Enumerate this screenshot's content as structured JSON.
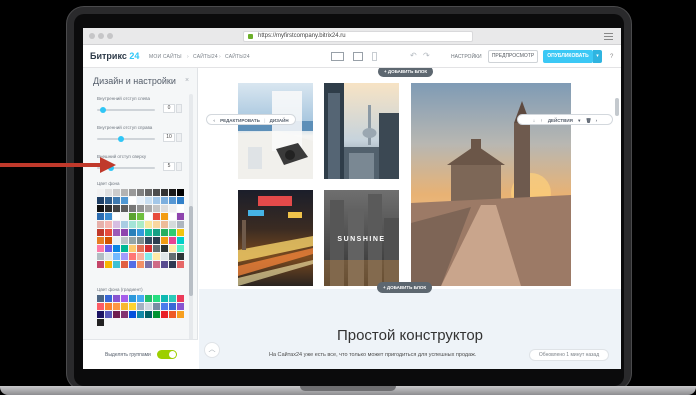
{
  "browser": {
    "url": "https://myfirstcompany.bitrix24.ru"
  },
  "toolbar": {
    "brand": "Битрикс",
    "brand_number": "24",
    "nav": [
      "МОИ САЙТЫ",
      "САЙТЫ24",
      "САЙТЫ24"
    ],
    "settings": "НАСТРОЙКИ",
    "preview": "ПРЕДПРОСМОТР",
    "publish": "ОПУБЛИКОВАТЬ",
    "help": "?"
  },
  "panel": {
    "title": "Дизайн и настройки",
    "close": "×",
    "fields": [
      {
        "label": "Внутренний отступ слева",
        "value": "0",
        "fraction": 0.05
      },
      {
        "label": "Внутренний отступ справа",
        "value": "10",
        "fraction": 0.4
      },
      {
        "label": "Внешний отступ сверху",
        "value": "5",
        "fraction": 0.22
      }
    ],
    "bg_color_label": "Цвет фона",
    "bg_gradient_label": "Цвет фона (градиент)",
    "footer_label": "Выделять группами",
    "toggle_on": true
  },
  "colors": {
    "accent": "#2fc6f6",
    "publish": "#3bc8f5",
    "toggle": "#9dcf00",
    "annotation": "#c0392b",
    "swatches_a": [
      "#f2f2f2",
      "#e0e0e0",
      "#cccccc",
      "#b3b3b3",
      "#999999",
      "#808080",
      "#666666",
      "#4d4d4d",
      "#333333",
      "#1a1a1a",
      "#000000",
      "#1e3f66",
      "#2e5c8a",
      "#3f7ab0",
      "#4f98d4",
      "#ffffff",
      "#e8f1fa",
      "#c9dff2",
      "#a3c7e8",
      "#7dafde",
      "#5797d3",
      "#3180c9",
      "#111111",
      "#2b2b2b",
      "#444444",
      "#5e5e5e",
      "#777777",
      "#919191",
      "#aaaaaa",
      "#c4c4c4",
      "#dddddd",
      "#f0f0f0",
      "#ffffff",
      "#2b6cb0",
      "#3c8dd0",
      "#ffffff",
      "#f5f5f5",
      "#5aa32f",
      "#6fbf3e",
      "#ffffff",
      "#e74c3c",
      "#f39c12",
      "#ffffff",
      "#8e44ad",
      "#e6b0aa",
      "#f5b7b1",
      "#d7bde2",
      "#a9cce3",
      "#a3e4d7",
      "#abebc6",
      "#f9e79f",
      "#fad7a0",
      "#edbb99",
      "#d5dbdb",
      "#aeb6bf",
      "#c0392b",
      "#e74c3c",
      "#9b59b6",
      "#8e44ad",
      "#2980b9",
      "#3498db",
      "#1abc9c",
      "#16a085",
      "#27ae60",
      "#2ecc71",
      "#f1c40f",
      "#e67e22",
      "#d35400",
      "#ecf0f1",
      "#bdc3c7",
      "#95a5a6",
      "#7f8c8d",
      "#34495e",
      "#2c3e50",
      "#f39c12",
      "#e84393",
      "#00cec9",
      "#fd79a8",
      "#6c5ce7",
      "#0984e3",
      "#00b894",
      "#fdcb6e",
      "#e17055",
      "#d63031",
      "#636e72",
      "#2d3436",
      "#ffeaa7",
      "#55efc4",
      "#b2bec3",
      "#dfe6e9",
      "#74b9ff",
      "#a29bfe",
      "#ff7675",
      "#fab1a0",
      "#81ecec",
      "#ffeaa7",
      "#dfe6e9",
      "#636e72",
      "#2d3436",
      "#c44569",
      "#f8b500",
      "#3dc1d3",
      "#e15f41",
      "#546de5",
      "#f19066",
      "#786fa6",
      "#cf6a87",
      "#574b90",
      "#303952",
      "#e66767"
    ],
    "swatches_b": [
      "#4b6584",
      "#3867d6",
      "#8854d0",
      "#a55eea",
      "#2d98da",
      "#45aaf2",
      "#20bf6b",
      "#26de81",
      "#0fb9b1",
      "#2bcbba",
      "#eb3b5a",
      "#fc5c65",
      "#fa8231",
      "#fd9644",
      "#f7b731",
      "#fed330",
      "#a5b1c2",
      "#d1d8e0",
      "#778ca3",
      "#4b7bec",
      "#3867d6",
      "#8854d0",
      "#1b1464",
      "#5758bb",
      "#6f1e51",
      "#833471",
      "#0652dd",
      "#1289a7",
      "#006266",
      "#009432",
      "#ea2027",
      "#ee5a24",
      "#f79f1f",
      "#222222"
    ]
  },
  "canvas": {
    "add_block": "+ ДОБАВИТЬ БЛОК",
    "edit": "РЕДАКТИРОВАТЬ",
    "design": "ДИЗАЙН",
    "actions": "ДЕЙСТВИЯ",
    "sunshine": "SUNSHINE",
    "heading": "Простой конструктор",
    "subtitle": "На Сайтах24 уже есть все, что только может пригодиться для успешных продаж.",
    "saved": "Обновлено 1 минут назад"
  }
}
